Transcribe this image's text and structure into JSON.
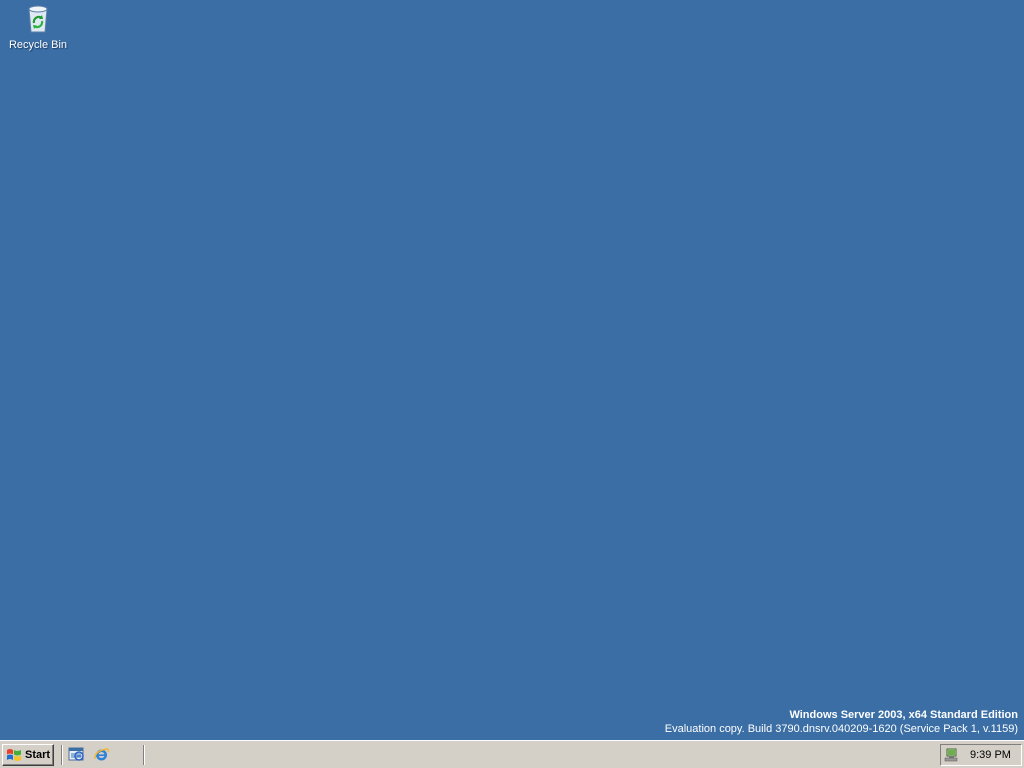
{
  "desktop": {
    "background_color": "#3a6ea5",
    "icons": [
      {
        "label": "Recycle Bin",
        "icon": "recycle-bin-icon"
      }
    ]
  },
  "watermark": {
    "edition": "Windows Server 2003, x64 Standard Edition",
    "build": "Evaluation copy. Build 3790.dnsrv.040209-1620 (Service Pack 1, v.1159)"
  },
  "taskbar": {
    "start_label": "Start",
    "quick_launch": [
      {
        "icon": "show-desktop-icon"
      },
      {
        "icon": "internet-explorer-icon"
      }
    ],
    "tray": {
      "icon": "network-icon",
      "clock": "9:39 PM"
    }
  }
}
